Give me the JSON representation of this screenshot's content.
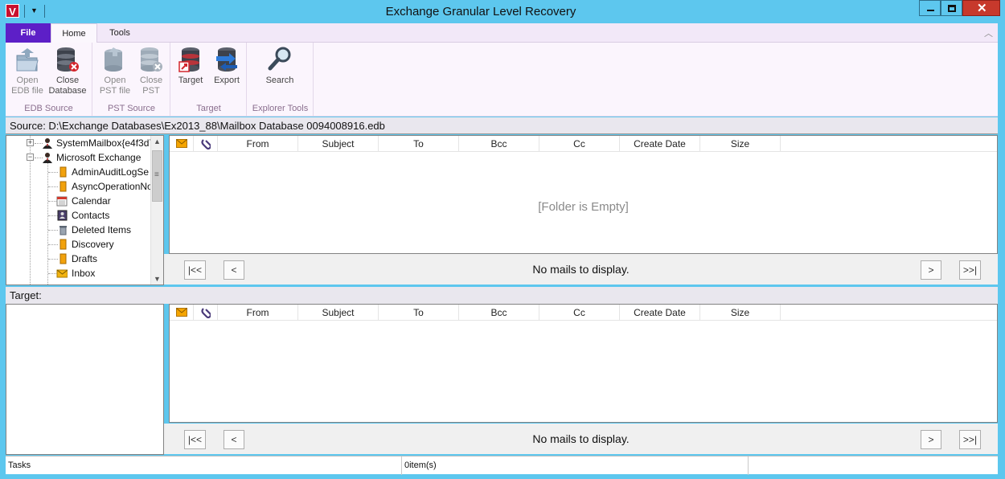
{
  "window": {
    "title": "Exchange Granular Level Recovery",
    "app_icon_letter": "V"
  },
  "ribbon": {
    "tabs": [
      {
        "label": "File"
      },
      {
        "label": "Home"
      },
      {
        "label": "Tools"
      }
    ],
    "groups": [
      {
        "label": "EDB Source",
        "buttons": [
          {
            "label_line1": "Open",
            "label_line2": "EDB file",
            "icon": "open-folder-icon"
          },
          {
            "label_line1": "Close",
            "label_line2": "Database",
            "icon": "close-database-icon"
          }
        ]
      },
      {
        "label": "PST Source",
        "buttons": [
          {
            "label_line1": "Open",
            "label_line2": "PST file",
            "icon": "open-pst-icon"
          },
          {
            "label_line1": "Close",
            "label_line2": "PST",
            "icon": "close-pst-icon"
          }
        ]
      },
      {
        "label": "Target",
        "buttons": [
          {
            "label_line1": "Target",
            "label_line2": "",
            "icon": "target-database-icon"
          },
          {
            "label_line1": "Export",
            "label_line2": "",
            "icon": "export-icon"
          }
        ]
      },
      {
        "label": "Explorer Tools",
        "buttons": [
          {
            "label_line1": "Search",
            "label_line2": "",
            "icon": "magnifier-icon"
          }
        ]
      }
    ]
  },
  "source": {
    "text": "Source: D:\\Exchange Databases\\Ex2013_88\\Mailbox Database 0094008916.edb"
  },
  "tree": {
    "items": [
      {
        "label": "SystemMailbox{e4f3d7",
        "level": 0,
        "expander": "+",
        "icon": "user-icon"
      },
      {
        "label": "Microsoft Exchange",
        "level": 0,
        "expander": "−",
        "icon": "user-icon"
      },
      {
        "label": "AdminAuditLogSe",
        "level": 1,
        "icon": "folder-icon"
      },
      {
        "label": "AsyncOperationNo",
        "level": 1,
        "icon": "folder-icon"
      },
      {
        "label": "Calendar",
        "level": 1,
        "icon": "calendar-icon"
      },
      {
        "label": "Contacts",
        "level": 1,
        "icon": "contacts-icon"
      },
      {
        "label": "Deleted Items",
        "level": 1,
        "icon": "trash-icon"
      },
      {
        "label": "Discovery",
        "level": 1,
        "icon": "folder-icon"
      },
      {
        "label": "Drafts",
        "level": 1,
        "icon": "folder-icon"
      },
      {
        "label": "Inbox",
        "level": 1,
        "icon": "inbox-icon"
      }
    ]
  },
  "mail_columns": [
    {
      "label": "",
      "icon": "envelope-icon"
    },
    {
      "label": "",
      "icon": "paperclip-icon"
    },
    {
      "label": "From"
    },
    {
      "label": "Subject"
    },
    {
      "label": "To"
    },
    {
      "label": "Bcc"
    },
    {
      "label": "Cc"
    },
    {
      "label": "Create Date"
    },
    {
      "label": "Size"
    }
  ],
  "source_mail": {
    "empty_text": "[Folder is Empty]",
    "pager_text": "No mails to display."
  },
  "target": {
    "label": "Target:",
    "pager_text": "No mails to display."
  },
  "pager_buttons": {
    "first": "|<<",
    "prev": "<",
    "next": ">",
    "last": ">>|"
  },
  "status": {
    "tasks": "Tasks",
    "items": "0item(s)",
    "extra": ""
  },
  "colors": {
    "window_frame": "#5dc7ee",
    "file_tab": "#5d1fc7",
    "ribbon_bg": "#fbf5fd",
    "close_button": "#c7392c"
  }
}
